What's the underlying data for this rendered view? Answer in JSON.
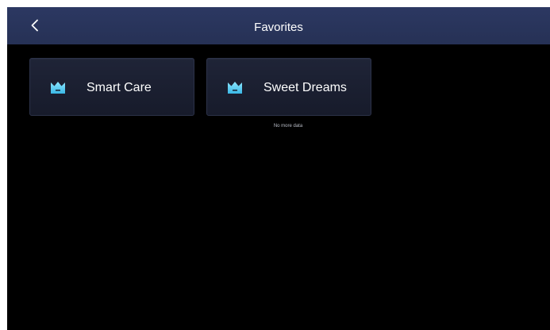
{
  "header": {
    "title": "Favorites",
    "back_icon": "chevron-left-icon"
  },
  "favorites": [
    {
      "label": "Smart Care",
      "icon": "crown-icon"
    },
    {
      "label": "Sweet Dreams",
      "icon": "crown-icon"
    }
  ],
  "list_footer": "No more data",
  "colors": {
    "header_bg": "#2a355d",
    "screen_bg": "#000000",
    "card_bg": "#1c2133",
    "icon_accent": "#5fd3f3"
  }
}
